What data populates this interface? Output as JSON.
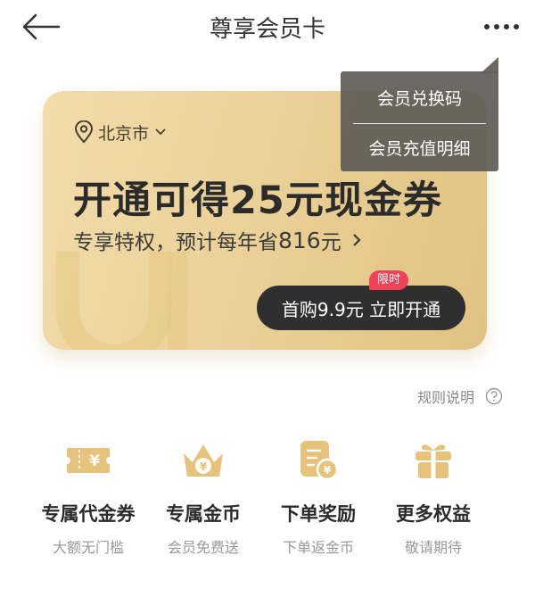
{
  "header": {
    "title": "尊享会员卡"
  },
  "menu": {
    "items": [
      {
        "label": "会员兑换码"
      },
      {
        "label": "会员充值明细"
      }
    ]
  },
  "card": {
    "city": "北京市",
    "headline": "开通可得25元现金券",
    "subline_prefix": "专享特权，预计每年省",
    "subline_amount": "816",
    "subline_unit": "元",
    "badge": "限时",
    "cta": "首购9.9元 立即开通"
  },
  "rules": {
    "label": "规则说明"
  },
  "benefits": [
    {
      "icon": "voucher-icon",
      "name": "专属代金券",
      "desc": "大额无门槛"
    },
    {
      "icon": "crown-coin-icon",
      "name": "专属金币",
      "desc": "会员免费送"
    },
    {
      "icon": "order-reward-icon",
      "name": "下单奖励",
      "desc": "下单返金币"
    },
    {
      "icon": "gift-icon",
      "name": "更多权益",
      "desc": "敬请期待"
    }
  ],
  "colors": {
    "card_gold": "#e9cf95",
    "icon_gold": "#e7c27a",
    "cta_dark": "#2f2f2f",
    "badge_red": "#f0425a"
  }
}
